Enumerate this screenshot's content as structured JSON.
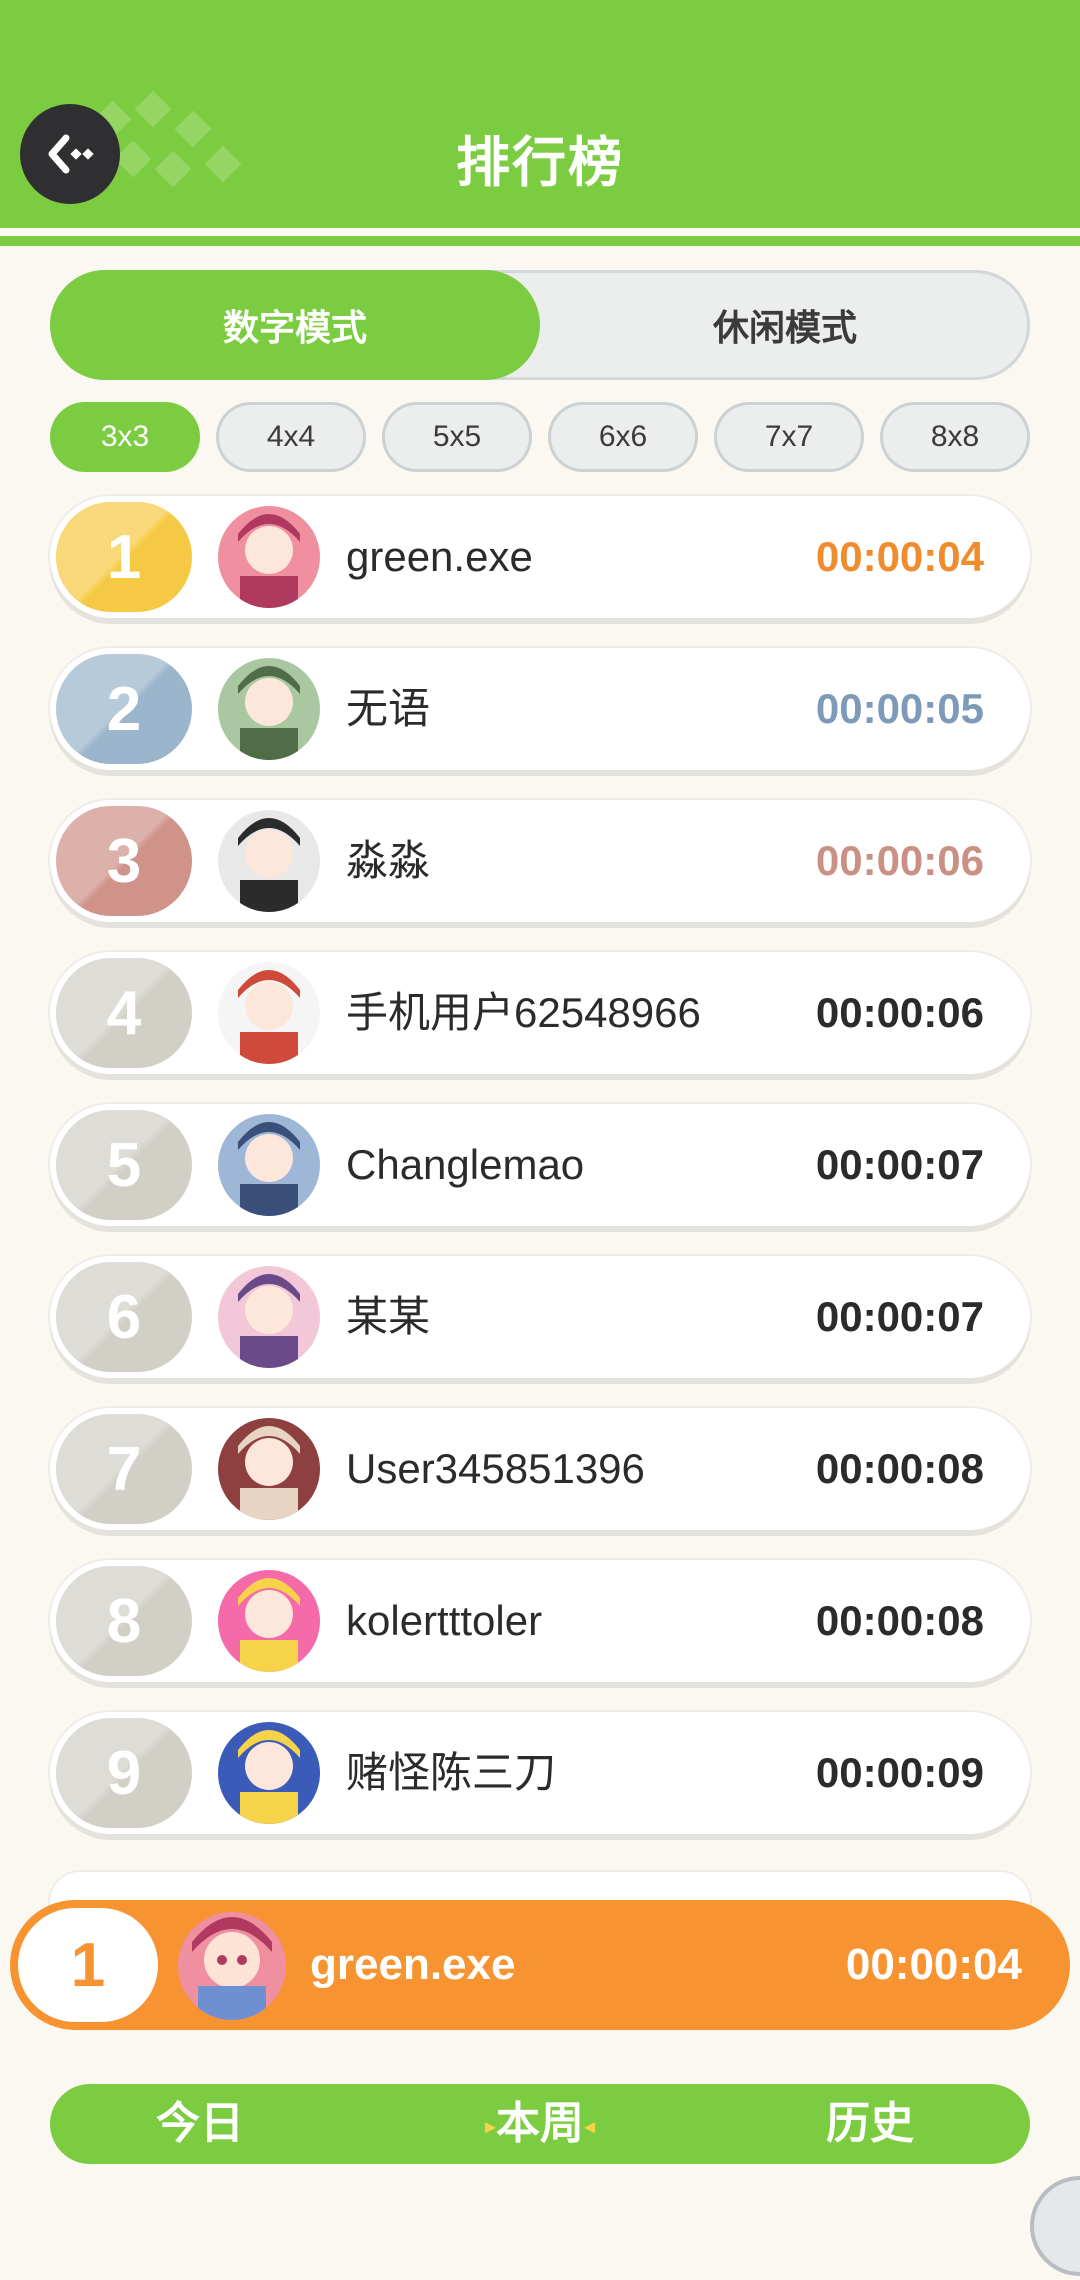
{
  "header": {
    "title": "排行榜",
    "back_icon": "back-arrow-icon"
  },
  "modes": {
    "active": "数字模式",
    "inactive": "休闲模式"
  },
  "sizes": [
    "3x3",
    "4x4",
    "5x5",
    "6x6",
    "7x7",
    "8x8"
  ],
  "selected_size": "3x3",
  "leaderboard": [
    {
      "rank": "1",
      "name": "green.exe",
      "time": "00:00:04",
      "rank_color": "#f6c944",
      "time_color": "#f08c2e"
    },
    {
      "rank": "2",
      "name": "无语",
      "time": "00:00:05",
      "rank_color": "#9bb6cc",
      "time_color": "#7d9ab8"
    },
    {
      "rank": "3",
      "name": "淼淼",
      "time": "00:00:06",
      "rank_color": "#cf938a",
      "time_color": "#c99083"
    },
    {
      "rank": "4",
      "name": "手机用户62548966",
      "time": "00:00:06",
      "rank_color": "#d1cfc6",
      "time_color": "#2b2b2b"
    },
    {
      "rank": "5",
      "name": "Changlemao",
      "time": "00:00:07",
      "rank_color": "#d1cfc6",
      "time_color": "#2b2b2b"
    },
    {
      "rank": "6",
      "name": "某某",
      "time": "00:00:07",
      "rank_color": "#d1cfc6",
      "time_color": "#2b2b2b"
    },
    {
      "rank": "7",
      "name": "User345851396",
      "time": "00:00:08",
      "rank_color": "#d1cfc6",
      "time_color": "#2b2b2b"
    },
    {
      "rank": "8",
      "name": "kolertttoler",
      "time": "00:00:08",
      "rank_color": "#d1cfc6",
      "time_color": "#2b2b2b"
    },
    {
      "rank": "9",
      "name": "赌怪陈三刀",
      "time": "00:00:09",
      "rank_color": "#d1cfc6",
      "time_color": "#2b2b2b"
    }
  ],
  "current_user": {
    "rank": "1",
    "name": "green.exe",
    "time": "00:00:04"
  },
  "periods": {
    "today": "今日",
    "week": "本周",
    "history": "历史",
    "selected": "本周"
  },
  "colors": {
    "brand_green": "#7ccc42",
    "accent_orange": "#f79331",
    "background": "#fbf8f1"
  }
}
